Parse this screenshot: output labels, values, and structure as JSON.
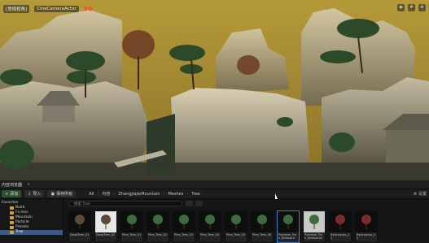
{
  "viewport": {
    "top_labels": [
      "[常规视角]",
      "CineCameraActor"
    ],
    "record_label": "录像",
    "right_icons": [
      "camera-icon",
      "grid-icon",
      "settings-icon"
    ]
  },
  "content_browser": {
    "title": "内容浏览器",
    "toolbar": {
      "add_label": "添加",
      "import_label": "导入",
      "save_all_label": "保存所有",
      "breadcrumb": [
        "All",
        "内容",
        "ZhangJiajieMountain",
        "Meshes",
        "Tree"
      ],
      "settings_label": "设置"
    },
    "tree": {
      "header": "Favorites",
      "items": [
        "Build",
        "Fx-less",
        "Mountain",
        "Particle",
        "Presets",
        "Tree"
      ],
      "selected": "Tree"
    },
    "search_placeholder": "搜索 Tree",
    "assets": [
      {
        "name": "DeadTree_01",
        "thumb": "dark"
      },
      {
        "name": "DeadTree_02",
        "thumb": "white"
      },
      {
        "name": "Pine_Tree_01",
        "thumb": "dark"
      },
      {
        "name": "Pine_Tree_02",
        "thumb": "dark"
      },
      {
        "name": "Pine_Tree_03",
        "thumb": "dark"
      },
      {
        "name": "Pine_Tree_04",
        "thumb": "dark"
      },
      {
        "name": "Pine_Tree_05",
        "thumb": "dark"
      },
      {
        "name": "Pine_Tree_06",
        "thumb": "dark"
      },
      {
        "name": "Pinetree_Tree_Billboard",
        "thumb": "dark"
      },
      {
        "name": "Pinetree_Tree_Billboard2",
        "thumb": "grey"
      },
      {
        "name": "RedLeaves_01",
        "thumb": "dark"
      },
      {
        "name": "RedLeaves_02",
        "thumb": "dark"
      }
    ]
  }
}
